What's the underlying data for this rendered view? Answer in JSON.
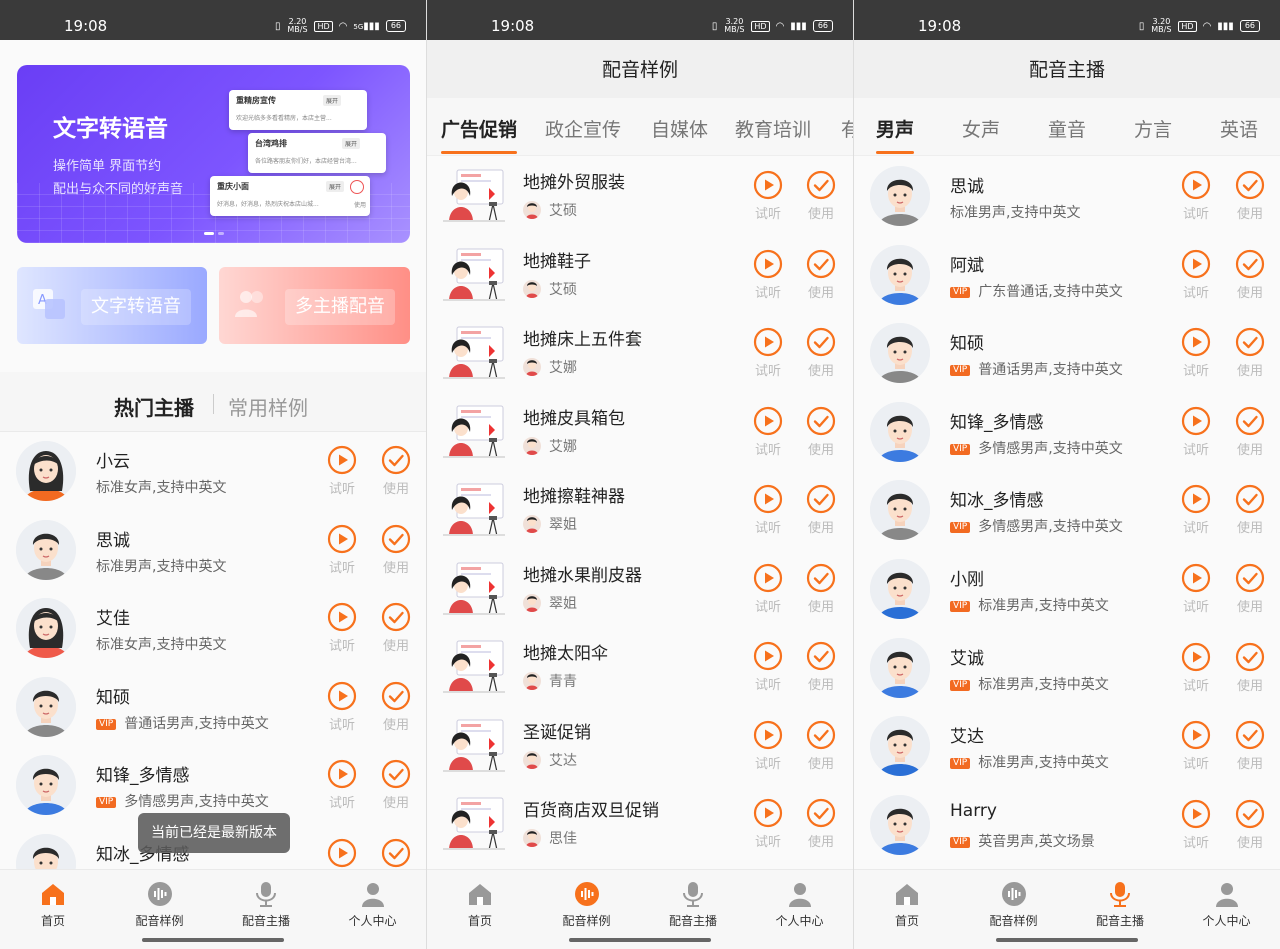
{
  "status": {
    "time": "19:08",
    "hd": "HD",
    "battery": "66",
    "signal": "5G"
  },
  "colors": {
    "accent": "#f7711c",
    "vip": "#f26a21",
    "banner": "#6a3ef5",
    "inactive_text": "#bbb"
  },
  "home": {
    "banner": {
      "title": "文字转语音",
      "sub1": "操作简单 界面节约",
      "sub2": "配出与众不同的好声音",
      "cards": [
        {
          "title": "重精房宣传",
          "tag": "展开",
          "text": "欢迎光临多多看看精房，本店主营..."
        },
        {
          "title": "台湾鸡排",
          "tag": "展开",
          "text": "各位路客朋友你们好，本店经营台湾..."
        },
        {
          "title": "重庆小面",
          "tag": "展开",
          "text": "好消息，好消息，热烈庆祝本店山城..."
        }
      ],
      "card_action": "使用"
    },
    "feature_cards": [
      {
        "label": "文字转语音"
      },
      {
        "label": "多主播配音"
      }
    ],
    "tabs": {
      "active": "热门主播",
      "inactive": "常用样例"
    },
    "list": [
      {
        "name": "小云",
        "desc": "标准女声,支持中英文",
        "vip": false
      },
      {
        "name": "思诚",
        "desc": "标准男声,支持中英文",
        "vip": false
      },
      {
        "name": "艾佳",
        "desc": "标准女声,支持中英文",
        "vip": false
      },
      {
        "name": "知硕",
        "desc": "普通话男声,支持中英文",
        "vip": true
      },
      {
        "name": "知锋_多情感",
        "desc": "多情感男声,支持中英文",
        "vip": true
      },
      {
        "name": "知冰_多情感",
        "desc": "",
        "vip": false
      }
    ],
    "toast": "当前已经是最新版本"
  },
  "samples": {
    "title": "配音样例",
    "tabs": [
      "广告促销",
      "政企宣传",
      "自媒体",
      "教育培训",
      "有"
    ],
    "list": [
      {
        "name": "地摊外贸服装",
        "author": "艾硕"
      },
      {
        "name": "地摊鞋子",
        "author": "艾硕"
      },
      {
        "name": "地摊床上五件套",
        "author": "艾娜"
      },
      {
        "name": "地摊皮具箱包",
        "author": "艾娜"
      },
      {
        "name": "地摊擦鞋神器",
        "author": "翠姐"
      },
      {
        "name": "地摊水果削皮器",
        "author": "翠姐"
      },
      {
        "name": "地摊太阳伞",
        "author": "青青"
      },
      {
        "name": "圣诞促销",
        "author": "艾达"
      },
      {
        "name": "百货商店双旦促销",
        "author": "思佳"
      }
    ]
  },
  "anchors": {
    "title": "配音主播",
    "tabs": [
      "男声",
      "女声",
      "童音",
      "方言",
      "英语"
    ],
    "list": [
      {
        "name": "思诚",
        "desc": "标准男声,支持中英文",
        "vip": false
      },
      {
        "name": "阿斌",
        "desc": "广东普通话,支持中英文",
        "vip": true
      },
      {
        "name": "知硕",
        "desc": "普通话男声,支持中英文",
        "vip": true
      },
      {
        "name": "知锋_多情感",
        "desc": "多情感男声,支持中英文",
        "vip": true
      },
      {
        "name": "知冰_多情感",
        "desc": "多情感男声,支持中英文",
        "vip": true
      },
      {
        "name": "小刚",
        "desc": "标准男声,支持中英文",
        "vip": true
      },
      {
        "name": "艾诚",
        "desc": "标准男声,支持中英文",
        "vip": true
      },
      {
        "name": "艾达",
        "desc": "标准男声,支持中英文",
        "vip": true
      },
      {
        "name": "Harry",
        "desc": "英音男声,英文场景",
        "vip": true
      }
    ]
  },
  "labels": {
    "listen": "试听",
    "use": "使用",
    "vip": "VIP"
  },
  "tabbar": [
    {
      "label": "首页",
      "icon": "home-icon"
    },
    {
      "label": "配音样例",
      "icon": "soundwave-icon"
    },
    {
      "label": "配音主播",
      "icon": "microphone-icon"
    },
    {
      "label": "个人中心",
      "icon": "user-icon"
    }
  ]
}
